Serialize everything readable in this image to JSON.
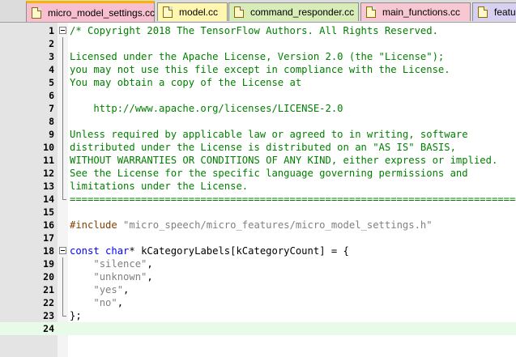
{
  "tabs": [
    {
      "label": "micro_model_settings.cc",
      "active": true,
      "color": "#f7bfd0",
      "width": 0
    },
    {
      "label": "model.cc",
      "active": false,
      "color": "#fff6b0"
    },
    {
      "label": "command_responder.cc",
      "active": false,
      "color": "#d8ecb8"
    },
    {
      "label": "main_functions.cc",
      "active": false,
      "color": "#f7c7d3"
    },
    {
      "label": "featu",
      "active": false,
      "color": "#d8d0f0"
    }
  ],
  "editor": {
    "current_line": 24,
    "lines": [
      {
        "n": "1",
        "parts": [
          {
            "t": "/* Copyright 2018 The TensorFlow Authors. All Rights Reserved.",
            "c": "cm"
          }
        ]
      },
      {
        "n": "2",
        "parts": []
      },
      {
        "n": "3",
        "parts": [
          {
            "t": "Licensed under the Apache License, Version 2.0 (the \"License\");",
            "c": "cm"
          }
        ]
      },
      {
        "n": "4",
        "parts": [
          {
            "t": "you may not use this file except in compliance with the License.",
            "c": "cm"
          }
        ]
      },
      {
        "n": "5",
        "parts": [
          {
            "t": "You may obtain a copy of the License at",
            "c": "cm"
          }
        ]
      },
      {
        "n": "6",
        "parts": []
      },
      {
        "n": "7",
        "parts": [
          {
            "t": "    http://www.apache.org/licenses/LICENSE-2.0",
            "c": "cm"
          }
        ]
      },
      {
        "n": "8",
        "parts": []
      },
      {
        "n": "9",
        "parts": [
          {
            "t": "Unless required by applicable law or agreed to in writing, software",
            "c": "cm"
          }
        ]
      },
      {
        "n": "10",
        "parts": [
          {
            "t": "distributed under the License is distributed on an \"AS IS\" BASIS,",
            "c": "cm"
          }
        ]
      },
      {
        "n": "11",
        "parts": [
          {
            "t": "WITHOUT WARRANTIES OR CONDITIONS OF ANY KIND, either express or implied.",
            "c": "cm"
          }
        ]
      },
      {
        "n": "12",
        "parts": [
          {
            "t": "See the License for the specific language governing permissions and",
            "c": "cm"
          }
        ]
      },
      {
        "n": "13",
        "parts": [
          {
            "t": "limitations under the License.",
            "c": "cm"
          }
        ]
      },
      {
        "n": "14",
        "parts": [
          {
            "t": "==============================================================================*/",
            "c": "cm"
          }
        ]
      },
      {
        "n": "15",
        "parts": []
      },
      {
        "n": "16",
        "parts": [
          {
            "t": "#include ",
            "c": "pp"
          },
          {
            "t": "\"micro_speech/micro_features/micro_model_settings.h\"",
            "c": "st"
          }
        ]
      },
      {
        "n": "17",
        "parts": []
      },
      {
        "n": "18",
        "parts": [
          {
            "t": "const",
            "c": "kw"
          },
          {
            "t": " ",
            "c": ""
          },
          {
            "t": "char",
            "c": "kw"
          },
          {
            "t": "* kCategoryLabels[kCategoryCount] = {",
            "c": ""
          }
        ]
      },
      {
        "n": "19",
        "parts": [
          {
            "t": "    ",
            "c": ""
          },
          {
            "t": "\"silence\"",
            "c": "st"
          },
          {
            "t": ",",
            "c": ""
          }
        ]
      },
      {
        "n": "20",
        "parts": [
          {
            "t": "    ",
            "c": ""
          },
          {
            "t": "\"unknown\"",
            "c": "st"
          },
          {
            "t": ",",
            "c": ""
          }
        ]
      },
      {
        "n": "21",
        "parts": [
          {
            "t": "    ",
            "c": ""
          },
          {
            "t": "\"yes\"",
            "c": "st"
          },
          {
            "t": ",",
            "c": ""
          }
        ]
      },
      {
        "n": "22",
        "parts": [
          {
            "t": "    ",
            "c": ""
          },
          {
            "t": "\"no\"",
            "c": "st"
          },
          {
            "t": ",",
            "c": ""
          }
        ]
      },
      {
        "n": "23",
        "parts": [
          {
            "t": "};",
            "c": ""
          }
        ]
      },
      {
        "n": "24",
        "parts": []
      }
    ]
  }
}
